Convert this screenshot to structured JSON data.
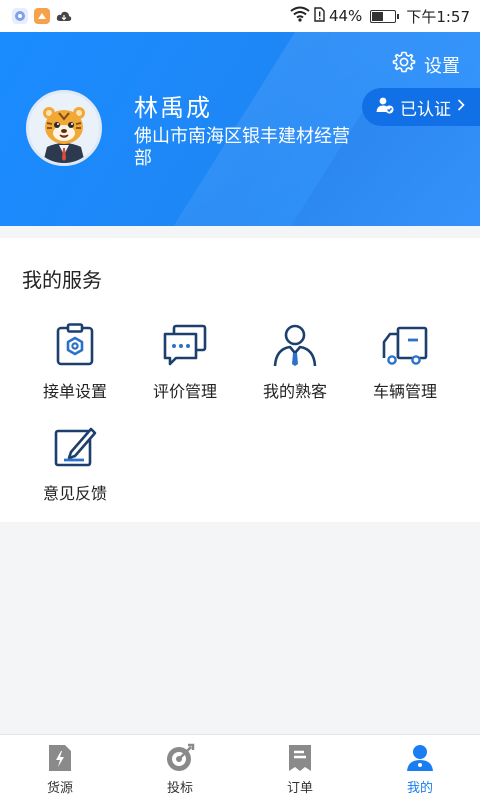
{
  "status_bar": {
    "battery_percent": "44%",
    "battery_level": 0.44,
    "time": "下午1:57"
  },
  "header": {
    "settings_label": "设置",
    "user_name": "林禹成",
    "company": "佛山市南海区银丰建材经营部",
    "verified_label": "已认证"
  },
  "services": {
    "title": "我的服务",
    "items": [
      {
        "label": "接单设置",
        "icon": "order-settings-icon"
      },
      {
        "label": "评价管理",
        "icon": "review-icon"
      },
      {
        "label": "我的熟客",
        "icon": "customer-icon"
      },
      {
        "label": "车辆管理",
        "icon": "truck-icon"
      },
      {
        "label": "意见反馈",
        "icon": "feedback-icon"
      }
    ]
  },
  "bottom_nav": {
    "items": [
      {
        "label": "货源",
        "icon": "cargo-icon"
      },
      {
        "label": "投标",
        "icon": "bid-icon"
      },
      {
        "label": "订单",
        "icon": "order-icon"
      },
      {
        "label": "我的",
        "icon": "profile-icon",
        "active": true
      }
    ]
  },
  "colors": {
    "primary": "#1a8cff",
    "icon_navy": "#1c3f6e",
    "nav_inactive": "#8a8a8a",
    "nav_active": "#1a7ef2"
  }
}
